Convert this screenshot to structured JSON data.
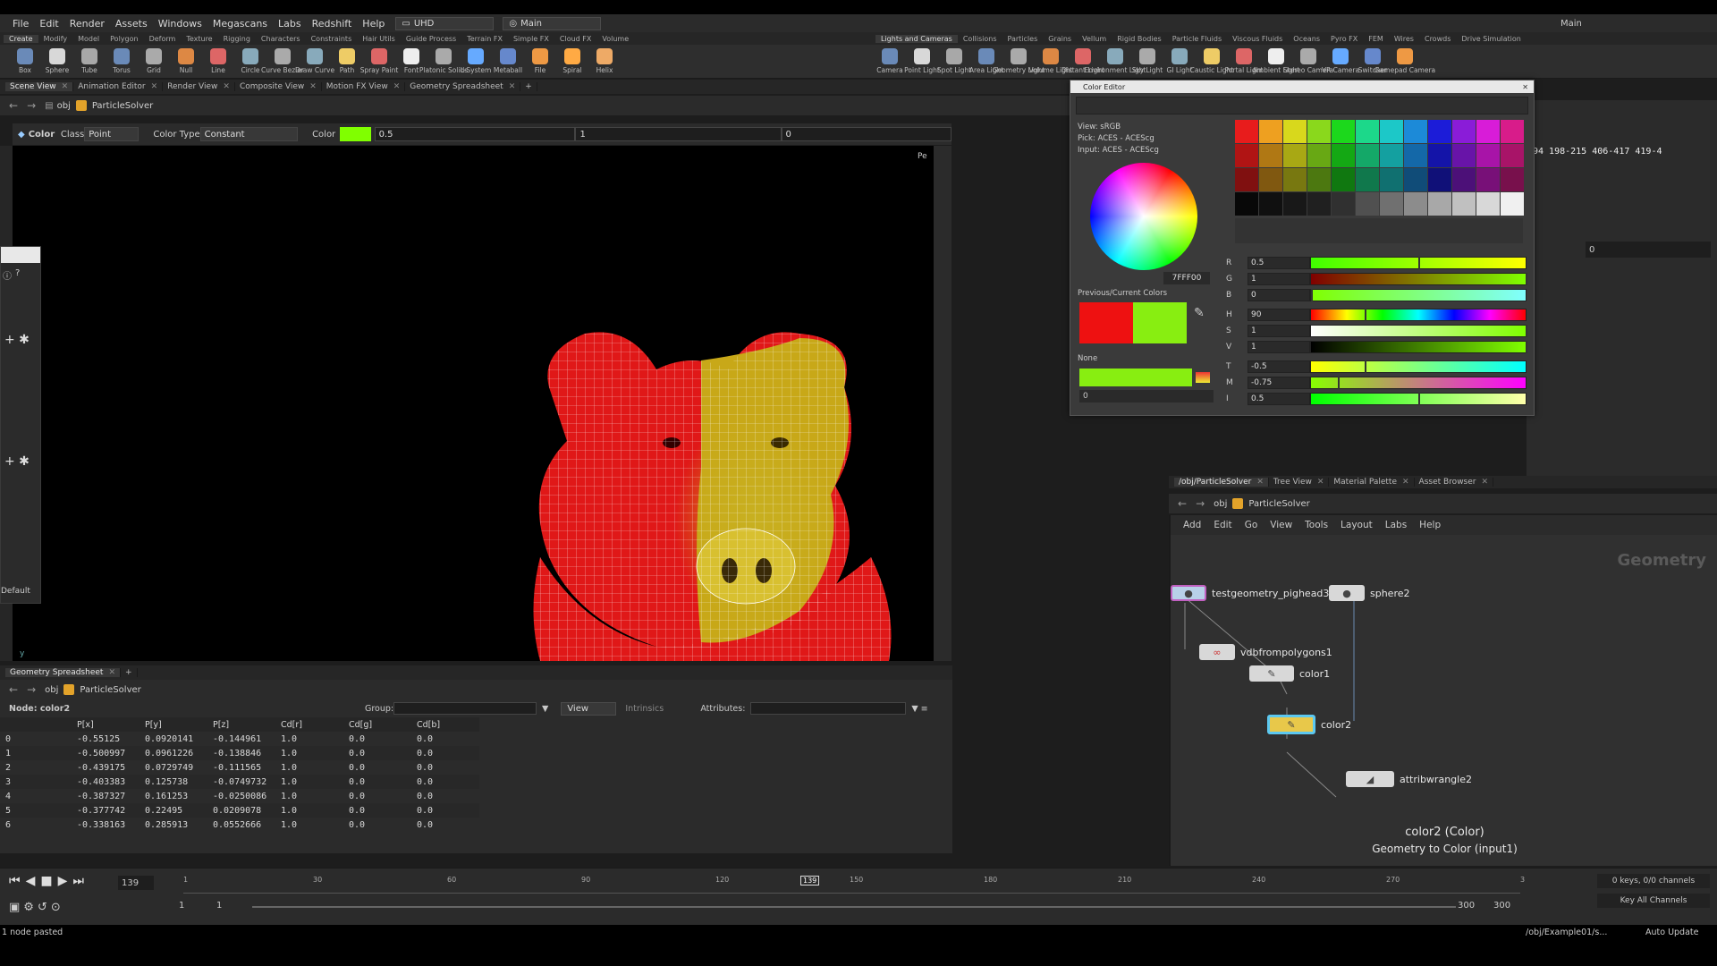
{
  "menubar": {
    "items": [
      "File",
      "Edit",
      "Render",
      "Assets",
      "Windows",
      "Megascans",
      "Labs",
      "Redshift",
      "Help"
    ],
    "desktop": "UHD",
    "desktop_name": "Main",
    "right_desktop": "Main"
  },
  "shelf_left": {
    "tabs": [
      "Create",
      "Modify",
      "Model",
      "Polygon",
      "Deform",
      "Texture",
      "Rigging",
      "Characters",
      "Constraints",
      "Hair Utils",
      "Guide Process",
      "Terrain FX",
      "Simple FX",
      "Cloud FX",
      "Volume"
    ],
    "tools": [
      "Box",
      "Sphere",
      "Tube",
      "Torus",
      "Grid",
      "Null",
      "Line",
      "Circle",
      "Curve Bezier",
      "Draw Curve",
      "Path",
      "Spray Paint",
      "Font",
      "Platonic Solids",
      "L-System",
      "Metaball",
      "File",
      "Spiral",
      "Helix"
    ]
  },
  "shelf_right": {
    "tabs": [
      "Lights and Cameras",
      "Collisions",
      "Particles",
      "Grains",
      "Vellum",
      "Rigid Bodies",
      "Particle Fluids",
      "Viscous Fluids",
      "Oceans",
      "Pyro FX",
      "FEM",
      "Wires",
      "Crowds",
      "Drive Simulation"
    ],
    "tools": [
      "Camera",
      "Point Light",
      "Spot Light",
      "Area Light",
      "Geometry Light",
      "Volume Light",
      "Distant Light",
      "Environment Light",
      "Sky Light",
      "GI Light",
      "Caustic Light",
      "Portal Light",
      "Ambient Light",
      "Stereo Camera",
      "VR Camera",
      "Switcher",
      "Gamepad Camera"
    ]
  },
  "viewer_tabs": [
    "Scene View",
    "Animation Editor",
    "Render View",
    "Composite View",
    "Motion FX View",
    "Geometry Spreadsheet"
  ],
  "path": {
    "obj": "obj",
    "node": "ParticleSolver"
  },
  "colorbar": {
    "title": "Color",
    "class_label": "Class",
    "class_value": "Point",
    "type_label": "Color Type",
    "type_value": "Constant",
    "color_label": "Color",
    "r": "0.5",
    "g": "1",
    "b": "0",
    "swatch": "#80ff00"
  },
  "viewport": {
    "axis": "y",
    "persp": "Pe"
  },
  "floatpanel": {
    "label": "Default"
  },
  "sheet": {
    "tab": "Geometry Spreadsheet",
    "node_label": "Node: color2",
    "group_label": "Group:",
    "view_label": "View",
    "intrinsics_label": "Intrinsics",
    "attributes_label": "Attributes:",
    "columns": [
      "",
      "P[x]",
      "P[y]",
      "P[z]",
      "Cd[r]",
      "Cd[g]",
      "Cd[b]"
    ],
    "rows": [
      [
        "0",
        "-0.55125",
        "0.0920141",
        "-0.144961",
        "1.0",
        "0.0",
        "0.0"
      ],
      [
        "1",
        "-0.500997",
        "0.0961226",
        "-0.138846",
        "1.0",
        "0.0",
        "0.0"
      ],
      [
        "2",
        "-0.439175",
        "0.0729749",
        "-0.111565",
        "1.0",
        "0.0",
        "0.0"
      ],
      [
        "3",
        "-0.403383",
        "0.125738",
        "-0.0749732",
        "1.0",
        "0.0",
        "0.0"
      ],
      [
        "4",
        "-0.387327",
        "0.161253",
        "-0.0250086",
        "1.0",
        "0.0",
        "0.0"
      ],
      [
        "5",
        "-0.377742",
        "0.22495",
        "0.0209078",
        "1.0",
        "0.0",
        "0.0"
      ],
      [
        "6",
        "-0.338163",
        "0.285913",
        "0.0552666",
        "1.0",
        "0.0",
        "0.0"
      ]
    ]
  },
  "coloreditor": {
    "title": "Color Editor",
    "view": "View:  sRGB",
    "pick": "Pick:  ACES - ACEScg",
    "input": "Input:  ACES - ACEScg",
    "hex": "7FFF00",
    "prev_label": "Previous/Current Colors",
    "prev_color": "#ee1111",
    "cur_color": "#88ee11",
    "none_label": "None",
    "none_value": "0",
    "sliders": [
      {
        "label": "R",
        "value": "0.5",
        "pos": 0.5
      },
      {
        "label": "G",
        "value": "1",
        "pos": 1.0
      },
      {
        "label": "B",
        "value": "0",
        "pos": 0.0
      },
      {
        "label": "H",
        "value": "90",
        "pos": 0.25
      },
      {
        "label": "S",
        "value": "1",
        "pos": 1.0
      },
      {
        "label": "V",
        "value": "1",
        "pos": 1.0
      },
      {
        "label": "T",
        "value": "-0.5",
        "pos": 0.25
      },
      {
        "label": "M",
        "value": "-0.75",
        "pos": 0.125
      },
      {
        "label": "I",
        "value": "0.5",
        "pos": 0.5
      }
    ],
    "swatches": [
      "#e81c1c",
      "#eea020",
      "#d8d81c",
      "#8ad81c",
      "#1cd81c",
      "#1cd88a",
      "#1cc8c8",
      "#1c8ad8",
      "#1c1cd8",
      "#8a1cd8",
      "#d81cd8",
      "#d81c8a",
      "#b01414",
      "#b07814",
      "#a8a814",
      "#68a814",
      "#14a814",
      "#14a868",
      "#14a0a0",
      "#1468a8",
      "#1414a8",
      "#6814a8",
      "#a814a8",
      "#a81468",
      "#801010",
      "#805810",
      "#787810",
      "#4c7810",
      "#107810",
      "#10784c",
      "#107070",
      "#104c78",
      "#101078",
      "#4c1078",
      "#781078",
      "#78104c",
      "#080808",
      "#101010",
      "#181818",
      "#202020",
      "#303030",
      "#505050",
      "#707070",
      "#8c8c8c",
      "#a8a8a8",
      "#c0c0c0",
      "#d8d8d8",
      "#f0f0f0"
    ]
  },
  "rightparm": {
    "coords": "94 198-215 406-417 419-4",
    "value": "0"
  },
  "network": {
    "tabs": [
      "/obj/ParticleSolver",
      "Tree View",
      "Material Palette",
      "Asset Browser"
    ],
    "path_obj": "obj",
    "path_node": "ParticleSolver",
    "menu": [
      "Add",
      "Edit",
      "Go",
      "View",
      "Tools",
      "Layout",
      "Labs",
      "Help"
    ],
    "context": "Geometry",
    "nodes": [
      "testgeometry_pighead3",
      "sphere2",
      "vdbfrompolygons1",
      "color1",
      "color2",
      "attribwrangle2"
    ],
    "info_title": "color2 (Color)",
    "info_sub": "Geometry to Color (input1)"
  },
  "timeline": {
    "frame": "139",
    "ticks": [
      "1",
      "30",
      "60",
      "90",
      "120",
      "139",
      "150",
      "180",
      "210",
      "240",
      "270",
      "3"
    ],
    "start": "1",
    "start2": "1",
    "end": "300",
    "end2": "300",
    "keys": "0 keys, 0/0 channels",
    "key_all": "Key All Channels"
  },
  "status": {
    "msg": "1 node pasted",
    "path": "/obj/Example01/s...",
    "update": "Auto Update"
  }
}
